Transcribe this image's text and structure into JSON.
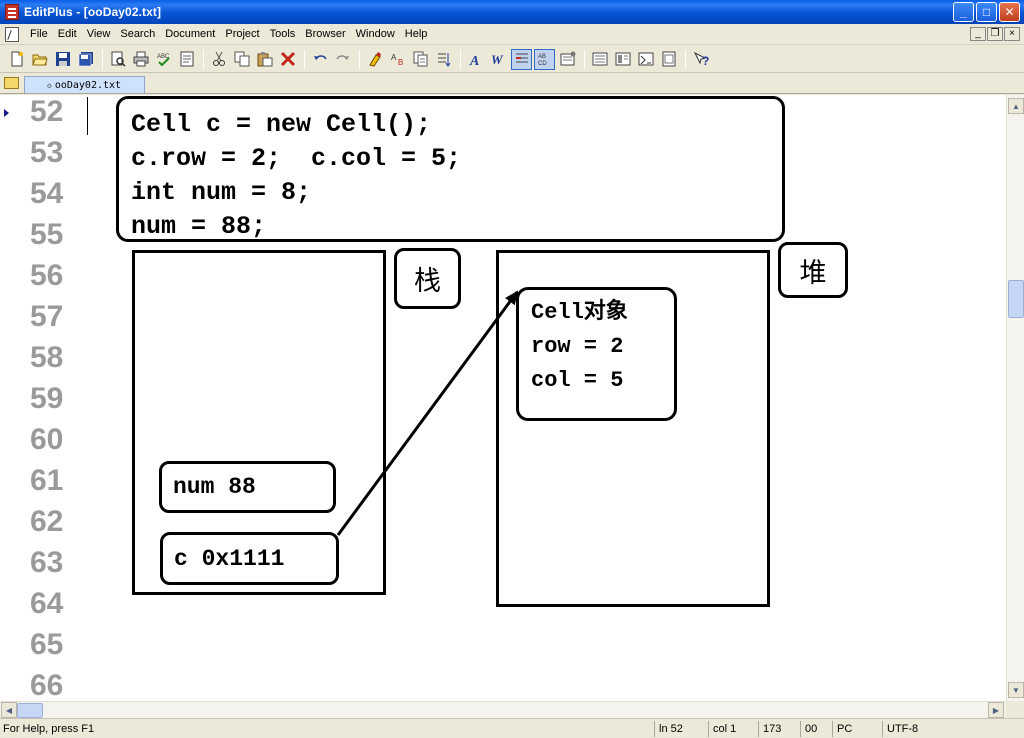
{
  "window": {
    "title": "EditPlus - [ooDay02.txt]",
    "controls": {
      "minimize": "_",
      "maximize": "□",
      "close": "✕"
    }
  },
  "menu": {
    "items": [
      "File",
      "Edit",
      "View",
      "Search",
      "Document",
      "Project",
      "Tools",
      "Browser",
      "Window",
      "Help"
    ],
    "mdi_controls": {
      "minimize": "_",
      "restore": "❐",
      "close": "×"
    }
  },
  "toolbar": {
    "icons": [
      "new-file-icon",
      "open-icon",
      "save-icon",
      "save-all-icon",
      "print-preview-icon",
      "print-icon",
      "spellcheck-icon",
      "browser-view-icon",
      "cut-icon",
      "copy-icon",
      "paste-icon",
      "delete-icon",
      "undo-icon",
      "redo-icon",
      "find-icon",
      "replace-icon",
      "find-in-files-icon",
      "goto-line-icon",
      "font-icon",
      "word-wrap-icon",
      "line-number-icon",
      "column-ruler-icon",
      "preferences-icon",
      "window-list-icon",
      "output-window-icon",
      "directory-icon",
      "cliptext-icon",
      "help-icon"
    ]
  },
  "tabs": {
    "file_tab": "ooDay02.txt"
  },
  "editor": {
    "line_numbers": [
      "52",
      "53",
      "54",
      "55",
      "56",
      "57",
      "58",
      "59",
      "60",
      "61",
      "62",
      "63",
      "64",
      "65",
      "66"
    ],
    "code_lines": [
      "Cell c = new Cell();",
      "c.row = 2;  c.col = 5;",
      "int num = 8;",
      "num = 88;"
    ],
    "stack_label": "栈",
    "heap_label": "堆",
    "object_lines": [
      "Cell对象",
      "row = 2",
      "col = 5"
    ],
    "num_var": "num 88",
    "ref_var": "c 0x1111",
    "arrow_color": "#000000"
  },
  "statusbar": {
    "help": "For Help, press F1",
    "line": "ln 52",
    "col": "col 1",
    "total": "173",
    "extra": "00",
    "mode": "PC",
    "encoding": "UTF-8"
  }
}
